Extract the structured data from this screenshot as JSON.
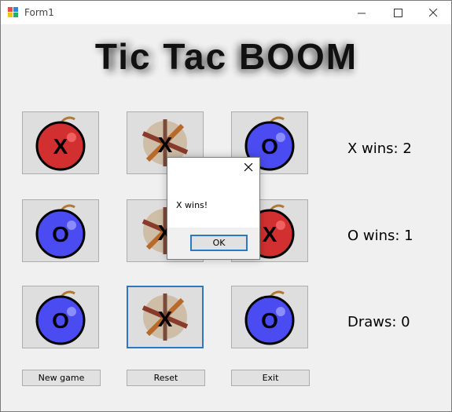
{
  "window": {
    "title": "Form1",
    "controls": [
      "minimize",
      "maximize",
      "close"
    ]
  },
  "banner": {
    "text": "Tic Tac BOOM"
  },
  "board": {
    "cells": [
      {
        "state": "X",
        "style": "red-bomb"
      },
      {
        "state": "X",
        "style": "explosion"
      },
      {
        "state": "O",
        "style": "blue-bomb"
      },
      {
        "state": "O",
        "style": "blue-bomb"
      },
      {
        "state": "X",
        "style": "explosion"
      },
      {
        "state": "X",
        "style": "red-bomb"
      },
      {
        "state": "O",
        "style": "blue-bomb"
      },
      {
        "state": "X",
        "style": "explosion"
      },
      {
        "state": "O",
        "style": "blue-bomb"
      }
    ],
    "colors": {
      "x_bomb": "#d23030",
      "o_bomb": "#4a4cf2",
      "fuse": "#b07830"
    }
  },
  "scores": {
    "x_wins": "X wins: 2",
    "o_wins": "O wins: 1",
    "draws": "Draws: 0"
  },
  "buttons": {
    "new_game": "New game",
    "reset": "Reset",
    "exit": "Exit"
  },
  "dialog": {
    "message": "X wins!",
    "ok_label": "OK",
    "close_icon": "close-icon"
  }
}
